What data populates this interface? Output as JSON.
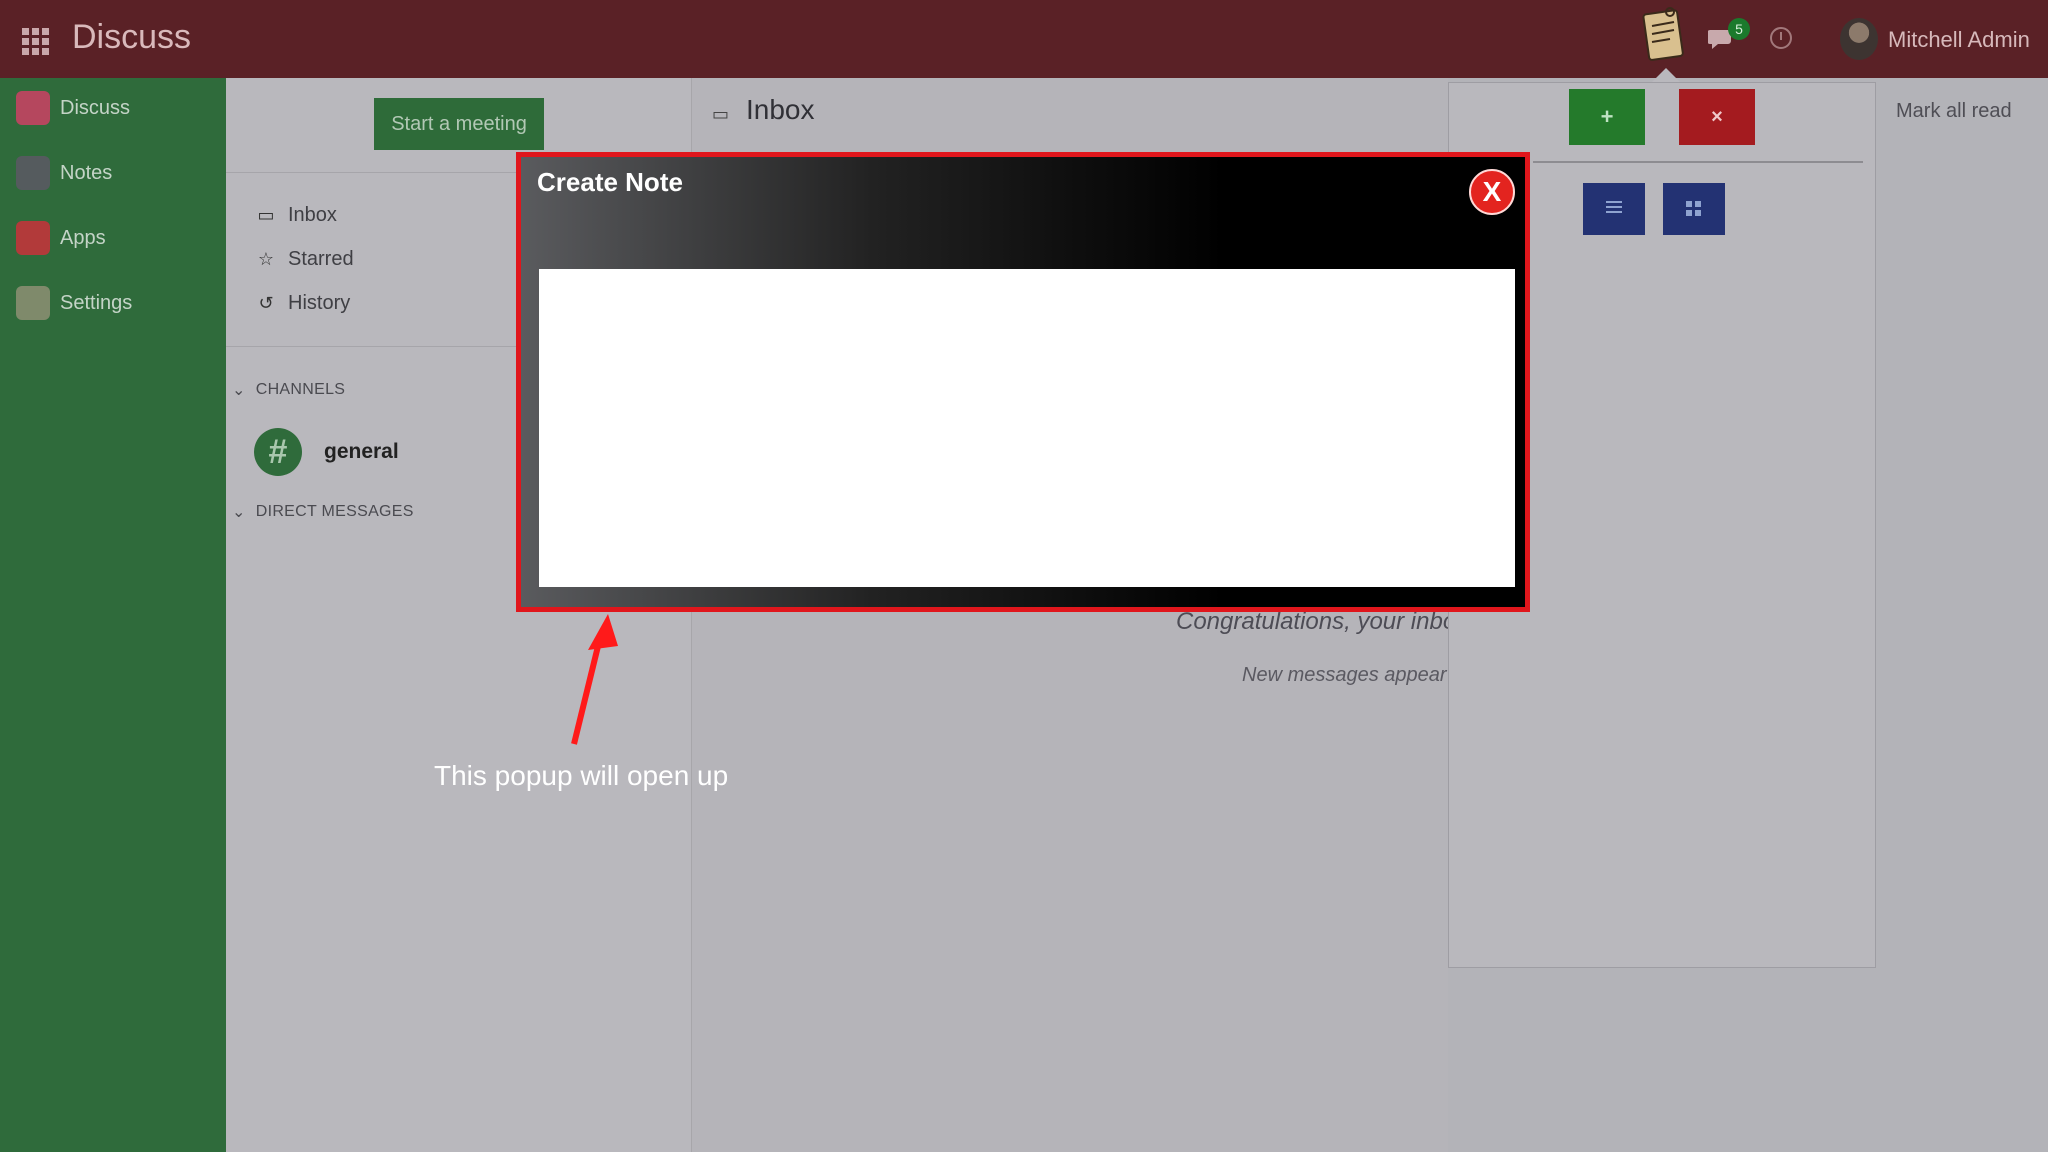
{
  "header": {
    "app_title": "Discuss",
    "chat_badge": "5",
    "user_name": "Mitchell Admin"
  },
  "leftnav": {
    "items": [
      {
        "label": "Discuss",
        "color": "#b5475e"
      },
      {
        "label": "Notes",
        "color": "#555b5e"
      },
      {
        "label": "Apps",
        "color": "#b23a3a"
      },
      {
        "label": "Settings",
        "color": "#7f8a6b"
      }
    ]
  },
  "sidebar": {
    "meeting_button": "Start a meeting",
    "mailboxes": [
      {
        "label": "Inbox",
        "icon": "inbox-icon"
      },
      {
        "label": "Starred",
        "icon": "star-icon"
      },
      {
        "label": "History",
        "icon": "history-icon"
      }
    ],
    "channels_heading": "CHANNELS",
    "channel_name": "general",
    "channel_symbol": "#",
    "direct_heading": "DIRECT MESSAGES"
  },
  "main": {
    "title": "Inbox",
    "empty_title": "Congratulations, your inbo",
    "empty_subtitle": "New messages appear"
  },
  "right_panel": {
    "add_label": "+",
    "close_label": "×",
    "mark_all_read": "Mark all read"
  },
  "popup": {
    "title": "Create Note",
    "close_label": "X",
    "note_value": ""
  },
  "annotation": {
    "text": "This popup will open up"
  },
  "colors": {
    "topbar": "#5a2126",
    "leftnav": "#2f6b3b",
    "popup_border": "#e0161c",
    "accent_green": "#247a2b",
    "accent_red": "#a41b1f",
    "accent_blue": "#233273"
  }
}
